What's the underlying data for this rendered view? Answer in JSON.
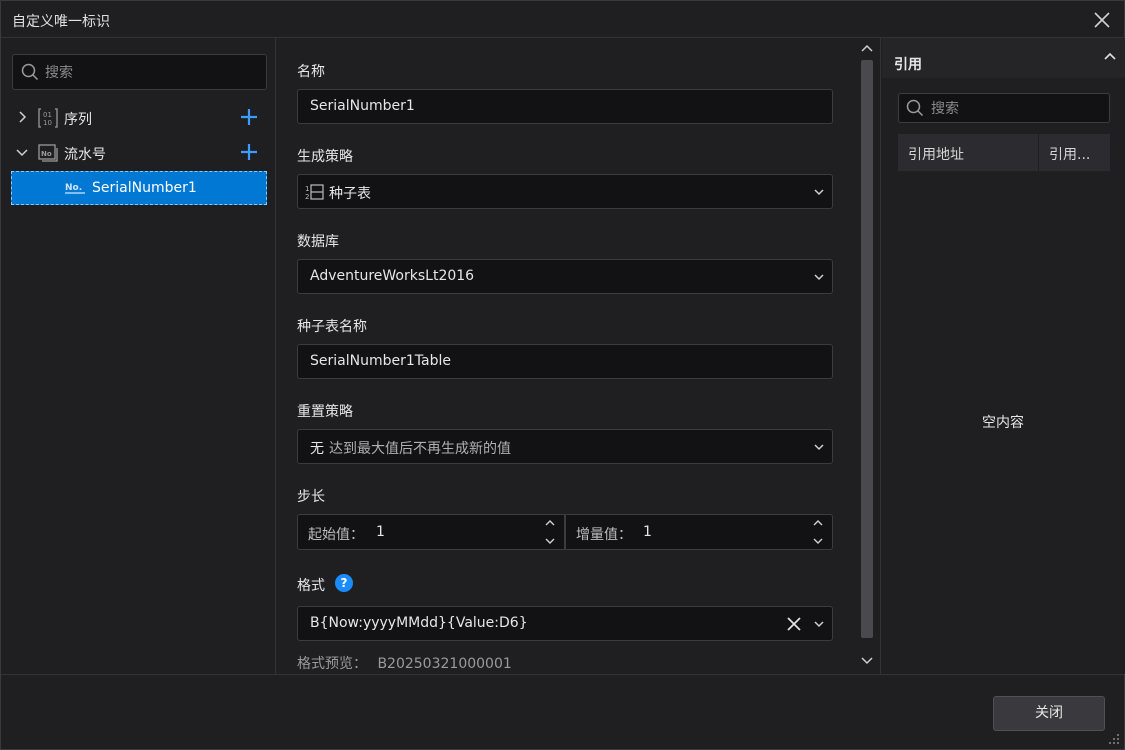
{
  "window": {
    "title": "自定义唯一标识"
  },
  "left": {
    "search_placeholder": "搜索",
    "tree": [
      {
        "label": "序列",
        "icon": "sequence-icon"
      },
      {
        "label": "流水号",
        "icon": "serial-number-icon"
      },
      {
        "label": "SerialNumber1",
        "icon": "no-badge-icon"
      }
    ]
  },
  "form": {
    "name_label": "名称",
    "name_value": "SerialNumber1",
    "strategy_label": "生成策略",
    "strategy_value": "种子表",
    "database_label": "数据库",
    "database_value": "AdventureWorksLt2016",
    "seed_table_label": "种子表名称",
    "seed_table_value": "SerialNumber1Table",
    "reset_label": "重置策略",
    "reset_value": "无",
    "reset_desc": "达到最大值后不再生成新的值",
    "step_label": "步长",
    "start_label": "起始值：",
    "start_value": "1",
    "increment_label": "增量值：",
    "increment_value": "1",
    "format_label": "格式",
    "help_glyph": "?",
    "format_value": "B{Now:yyyyMMdd}{Value:D6}",
    "preview_label": "格式预览：",
    "preview_value": "B20250321000001"
  },
  "references": {
    "title": "引用",
    "search_placeholder": "搜索",
    "col_address": "引用地址",
    "col_ref": "引用...",
    "empty_text": "空内容"
  },
  "footer": {
    "close_label": "关闭"
  },
  "colors": {
    "accent": "#0078d4",
    "plus": "#3b9bff",
    "help": "#1a8cff"
  }
}
